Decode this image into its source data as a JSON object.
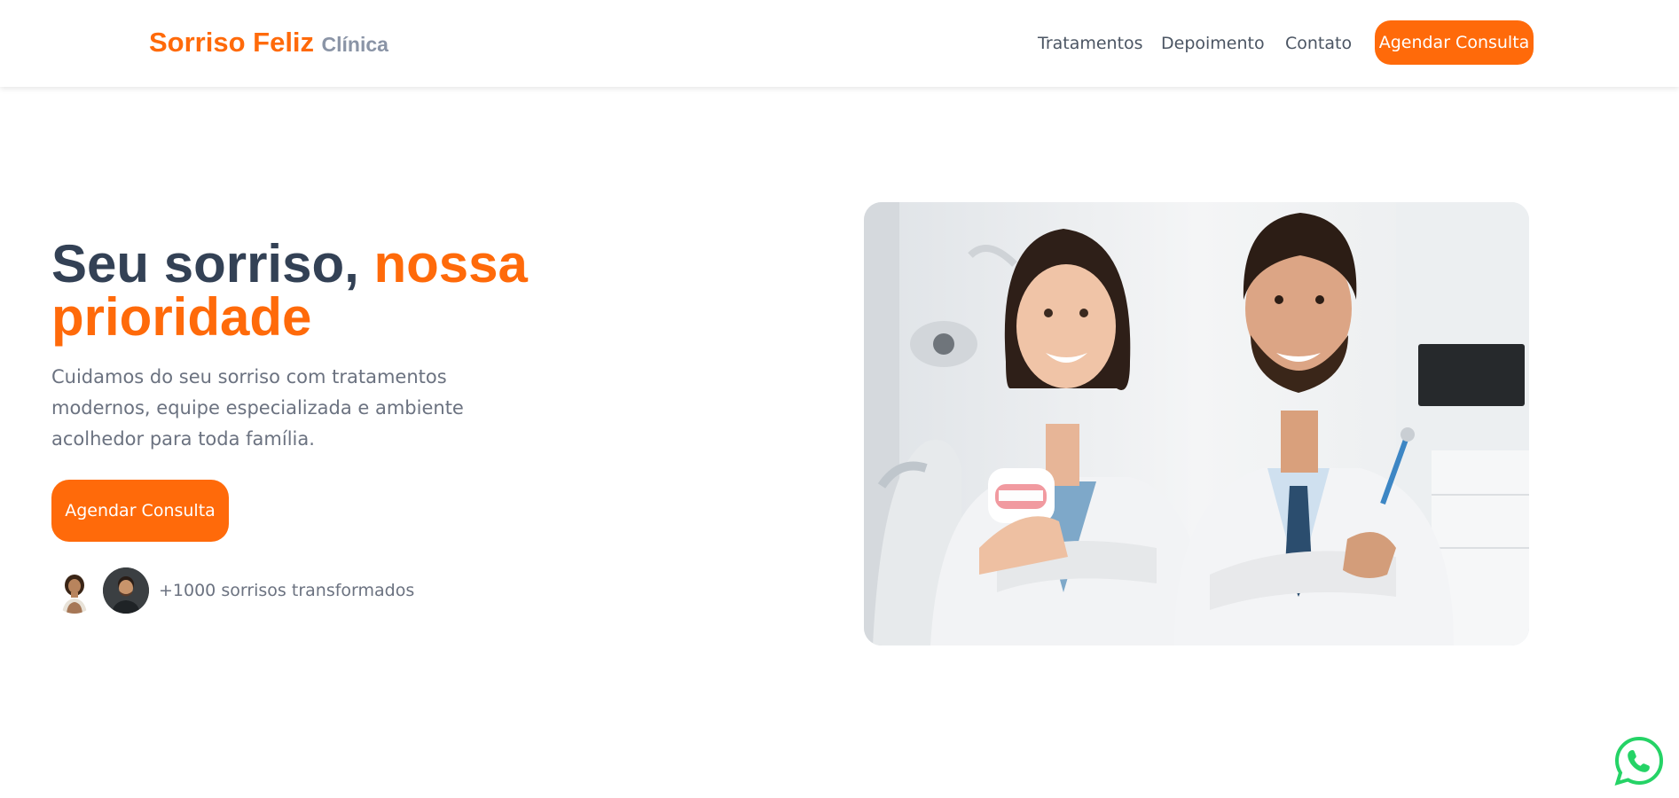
{
  "brand": {
    "name": "Sorriso Feliz",
    "sub": "Clínica"
  },
  "nav": {
    "items": [
      "Tratamentos",
      "Depoimento",
      "Contato"
    ],
    "cta_label": "Agendar Consulta"
  },
  "hero": {
    "title_part1": "Seu sorriso, ",
    "title_part2": "nossa prioridade",
    "description": "Cuidamos do seu sorriso com tratamentos modernos, equipe especializada e ambiente acolhedor para toda família.",
    "cta_label": "Agendar Consulta",
    "social_proof": "+1000 sorrisos transformados"
  },
  "colors": {
    "accent": "#ff6a0a",
    "heading": "#334155",
    "text": "#6b7280",
    "whatsapp": "#25d366"
  },
  "icons": {
    "whatsapp": "whatsapp-icon"
  }
}
